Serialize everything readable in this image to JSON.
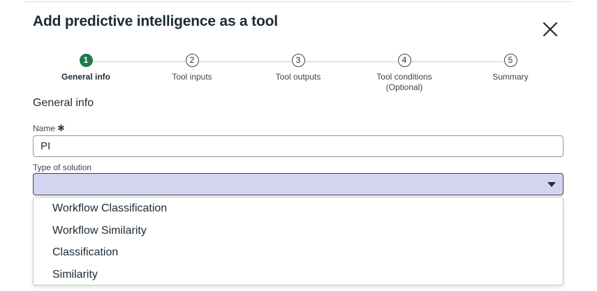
{
  "modal": {
    "title": "Add predictive intelligence as a tool"
  },
  "stepper": {
    "steps": [
      {
        "number": "1",
        "label": "General info",
        "sublabel": ""
      },
      {
        "number": "2",
        "label": "Tool inputs",
        "sublabel": ""
      },
      {
        "number": "3",
        "label": "Tool outputs",
        "sublabel": ""
      },
      {
        "number": "4",
        "label": "Tool conditions",
        "sublabel": "(Optional)"
      },
      {
        "number": "5",
        "label": "Summary",
        "sublabel": ""
      }
    ],
    "active_step": 1
  },
  "form": {
    "section_title": "General info",
    "name": {
      "label": "Name",
      "required_marker": "✱",
      "value": "PI"
    },
    "solution_type": {
      "label": "Type of solution",
      "value": "",
      "options": [
        "Workflow Classification",
        "Workflow Similarity",
        "Classification",
        "Similarity"
      ]
    }
  },
  "colors": {
    "active_step": "#1f7a4d",
    "select_focus_bg": "#d2d4f0",
    "text": "#1d2b36"
  },
  "icons": {
    "close": "close-icon",
    "caret": "caret-down-icon"
  }
}
